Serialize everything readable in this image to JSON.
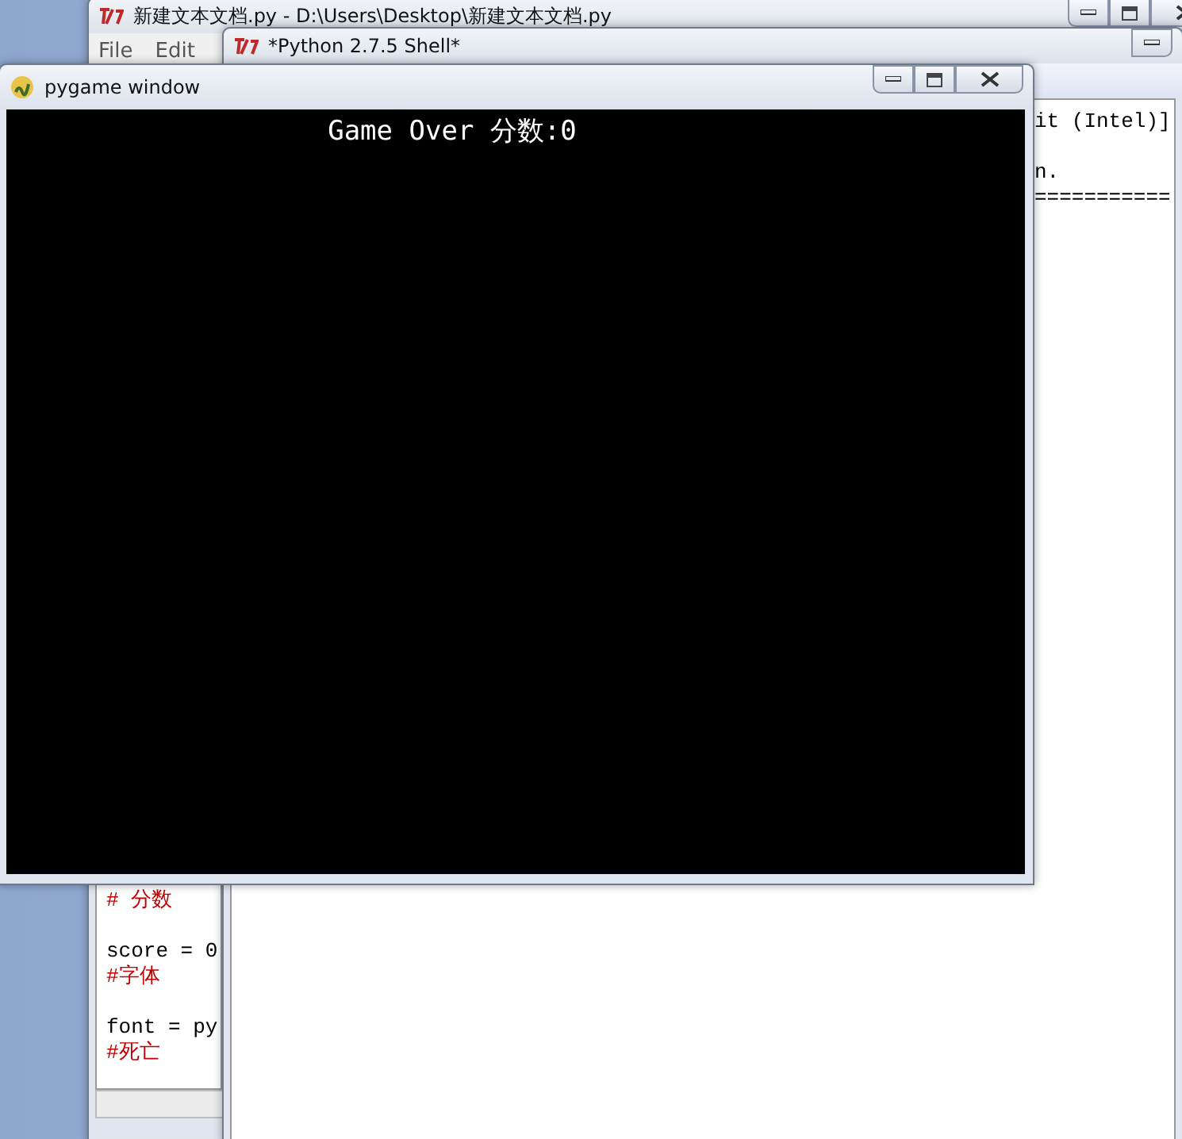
{
  "windows": [
    {
      "kind": "editor",
      "title": "新建文本文档.py - D:\\Users\\Desktop\\新建文本文档.py",
      "menu": [
        "File",
        "Edit"
      ],
      "blocks": [
        [
          {
            "text": "# 分数",
            "kind": "comment"
          }
        ],
        [
          {
            "text": "score = 0",
            "kind": "code"
          },
          {
            "text": "#字体",
            "kind": "comment"
          }
        ],
        [
          {
            "text": "font = py",
            "kind": "code"
          },
          {
            "text": "#死亡",
            "kind": "comment"
          }
        ]
      ]
    },
    {
      "kind": "shell",
      "title": "*Python 2.7.5 Shell*",
      "blocks": [
        [
          "it (Intel)]"
        ],
        [
          "n.",
          "==========="
        ]
      ]
    },
    {
      "kind": "game",
      "title": "pygame window",
      "message": "Game Over 分数:0"
    }
  ]
}
